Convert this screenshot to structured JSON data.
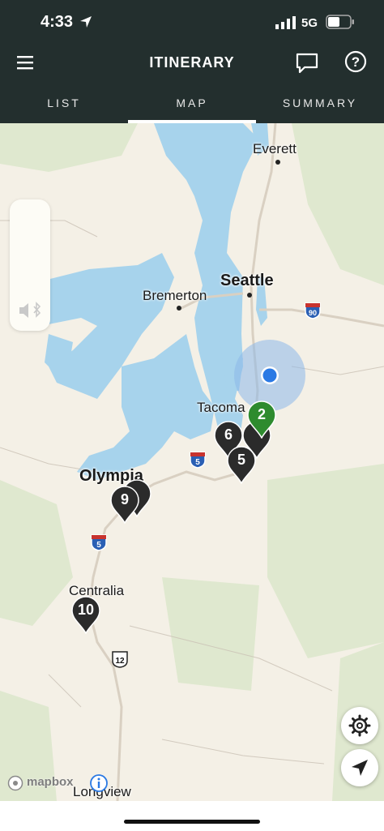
{
  "status_bar": {
    "time": "4:33",
    "network": "5G"
  },
  "header": {
    "title": "ITINERARY",
    "menu_icon": "hamburger-menu-icon",
    "chat_icon": "chat-icon",
    "help_icon": "help-icon"
  },
  "tabs": [
    {
      "label": "LIST"
    },
    {
      "label": "MAP",
      "active": true
    },
    {
      "label": "SUMMARY"
    }
  ],
  "map": {
    "cities": [
      {
        "name": "Everett"
      },
      {
        "name": "Seattle"
      },
      {
        "name": "Bremerton"
      },
      {
        "name": "Tacoma"
      },
      {
        "name": "Olympia"
      },
      {
        "name": "Centralia"
      },
      {
        "name": "Longview"
      }
    ],
    "highway_shields": [
      "90",
      "5",
      "5",
      "12"
    ],
    "stops": [
      {
        "number": "2",
        "color": "#2e8b2e"
      },
      {
        "number": "6",
        "color": "#2b2b2b"
      },
      {
        "number": "5",
        "color": "#2b2b2b"
      },
      {
        "number": "9",
        "color": "#2b2b2b"
      },
      {
        "number": "10",
        "color": "#2b2b2b"
      }
    ],
    "attribution": "mapbox"
  }
}
